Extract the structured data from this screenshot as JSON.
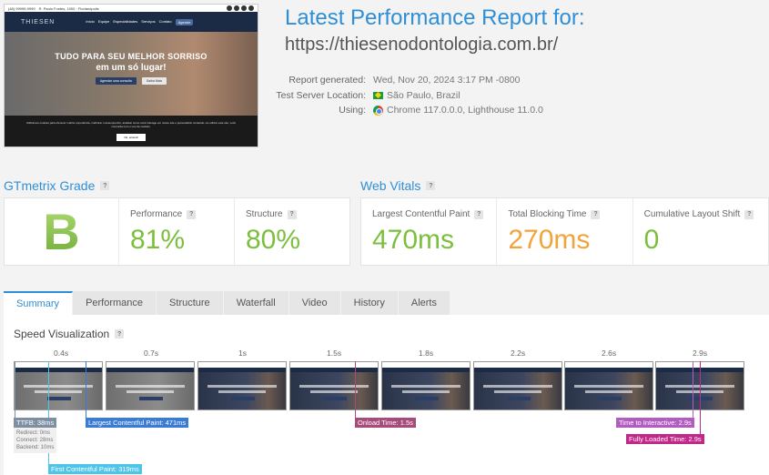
{
  "site_screenshot": {
    "nav_logo": "THIESEN",
    "hero_title": "TUDO PARA SEU MELHOR SORRISO",
    "hero_subtitle": "em um só lugar!",
    "btn_primary": "Agendar uma consulta",
    "btn_secondary": "Saiba Mais",
    "cookie_text": "Utilizamos cookies para oferecer melhor experiência, melhorar o desempenho, analisar como você interage em nosso site e personalizar conteúdo. Ao utilizar este site, você concorda com o uso de cookies.",
    "cookie_ok": "Ok, entendi"
  },
  "report": {
    "title": "Latest Performance Report for:",
    "url": "https://thiesenodontologia.com.br/",
    "generated_label": "Report generated:",
    "generated_value": "Wed, Nov 20, 2024 3:17 PM -0800",
    "location_label": "Test Server Location:",
    "location_value": "São Paulo, Brazil",
    "using_label": "Using:",
    "using_value": "Chrome 117.0.0.0, Lighthouse 11.0.0"
  },
  "grade": {
    "heading": "GTmetrix Grade",
    "letter": "B",
    "performance_label": "Performance",
    "performance_value": "81%",
    "structure_label": "Structure",
    "structure_value": "80%"
  },
  "vitals": {
    "heading": "Web Vitals",
    "lcp_label": "Largest Contentful Paint",
    "lcp_value": "470ms",
    "tbt_label": "Total Blocking Time",
    "tbt_value": "270ms",
    "cls_label": "Cumulative Layout Shift",
    "cls_value": "0"
  },
  "tabs": [
    "Summary",
    "Performance",
    "Structure",
    "Waterfall",
    "Video",
    "History",
    "Alerts"
  ],
  "speed": {
    "heading": "Speed Visualization",
    "times": [
      "0.4s",
      "0.7s",
      "1s",
      "1.5s",
      "1.8s",
      "2.2s",
      "2.6s",
      "2.9s"
    ],
    "ttfb": "TTFB: 38ms",
    "ttfb_detail_redirect": "Redirect: 0ms",
    "ttfb_detail_connect": "Connect: 28ms",
    "ttfb_detail_backend": "Backend: 10ms",
    "lcp": "Largest Contentful Paint: 471ms",
    "fcp": "First Contentful Paint: 319ms",
    "onload": "Onload Time: 1.5s",
    "tti": "Time to Interactive: 2.9s",
    "fully_loaded": "Fully Loaded Time: 2.9s"
  },
  "colors": {
    "accent": "#2f8fd6",
    "grade_green": "#7cbf3c",
    "warn_orange": "#f2a33a",
    "ttfb": "#7d8fa3",
    "lcp": "#3a7bd5",
    "fcp": "#4cc5e8",
    "onload": "#a74b7a",
    "tti": "#b25cc2",
    "fully_loaded": "#c2278a"
  }
}
